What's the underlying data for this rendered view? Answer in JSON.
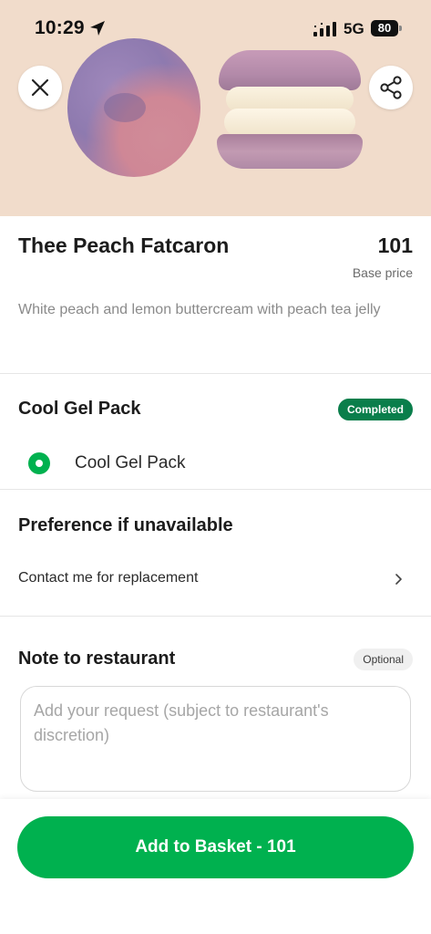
{
  "status_bar": {
    "time": "10:29",
    "network": "5G",
    "battery": "80"
  },
  "header": {
    "hero_image": "macaron-photo",
    "close_icon": "close-icon",
    "share_icon": "share-icon"
  },
  "item": {
    "title": "Thee Peach Fatcaron",
    "price": "101",
    "price_caption": "Base price",
    "description": "White peach and lemon buttercream with peach tea jelly"
  },
  "cool_gel_section": {
    "title": "Cool Gel Pack",
    "badge": "Completed",
    "option_label": "Cool Gel Pack",
    "option_selected": true
  },
  "preference_section": {
    "title": "Preference if unavailable",
    "value": "Contact me for replacement"
  },
  "note_section": {
    "title": "Note to restaurant",
    "badge": "Optional",
    "placeholder": "Add your request (subject to restaurant's discretion)",
    "value": ""
  },
  "cta": {
    "label": "Add to Basket - 101"
  },
  "colors": {
    "brand_green": "#00b14f",
    "completed_badge": "#0a7e4b",
    "hero_background": "#f1dccb"
  }
}
